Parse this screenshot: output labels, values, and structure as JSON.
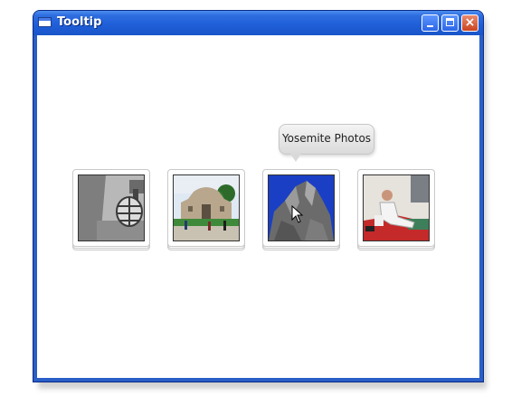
{
  "window": {
    "title": "Tooltip",
    "controls": {
      "minimize_icon": "minimize-icon",
      "maximize_icon": "maximize-icon",
      "close_icon": "close-icon",
      "close_glyph": "×"
    }
  },
  "gallery": {
    "photos": [
      {
        "subject": "lamp"
      },
      {
        "subject": "alamo"
      },
      {
        "subject": "mountain"
      },
      {
        "subject": "karate"
      }
    ],
    "hovered_index": 2,
    "tooltip": "Yosemite Photos"
  },
  "colors": {
    "titlebar": "#2f6ee0",
    "close_button": "#c94421",
    "tooltip_bg": "#e8e8e8"
  }
}
